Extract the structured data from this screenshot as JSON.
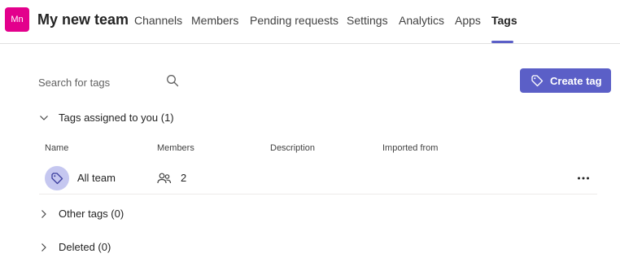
{
  "header": {
    "avatar_initials": "Mn",
    "team_name": "My new team",
    "tabs": [
      {
        "label": "Channels"
      },
      {
        "label": "Members"
      },
      {
        "label": "Pending requests"
      },
      {
        "label": "Settings"
      },
      {
        "label": "Analytics"
      },
      {
        "label": "Apps"
      },
      {
        "label": "Tags",
        "active": true
      }
    ]
  },
  "search": {
    "placeholder": "Search for tags",
    "value": ""
  },
  "create_button": {
    "label": "Create tag"
  },
  "sections": {
    "assigned": {
      "label": "Tags assigned to you (1)",
      "expanded": true
    },
    "other": {
      "label": "Other tags (0)",
      "expanded": false
    },
    "deleted": {
      "label": "Deleted (0)",
      "expanded": false
    }
  },
  "table": {
    "columns": [
      "Name",
      "Members",
      "Description",
      "Imported from"
    ],
    "rows": [
      {
        "name": "All team",
        "members": "2",
        "description": "",
        "imported_from": ""
      }
    ]
  },
  "colors": {
    "accent": "#5b5fc7",
    "avatar": "#e3008c",
    "tag_avatar_bg": "#c5c7f0"
  }
}
